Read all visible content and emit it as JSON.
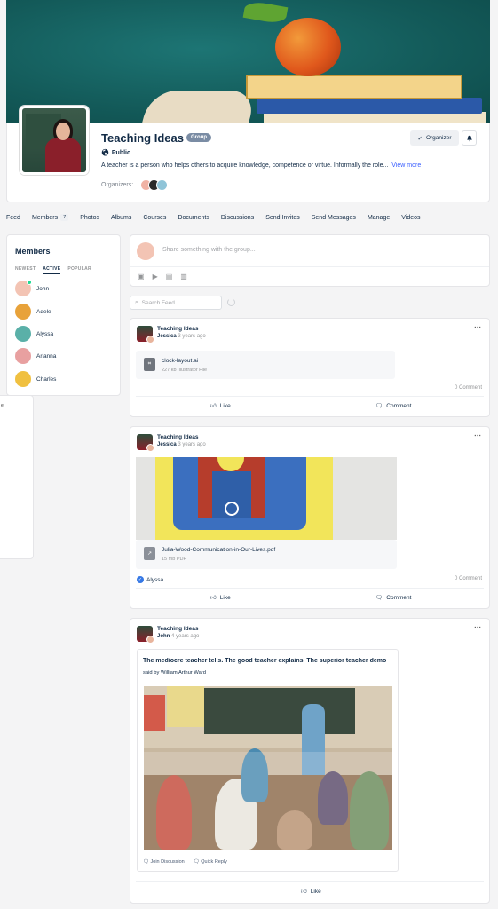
{
  "group": {
    "title": "Teaching Ideas",
    "badge": "Group",
    "privacy": "Public",
    "description": "A teacher is a person who helps others to acquire knowledge, competence or virtue. Informally the role...",
    "view_more": "View more",
    "organizers_label": "Organizers:",
    "organizer_button": "Organizer"
  },
  "nav": {
    "items": [
      "Feed",
      "Members",
      "Photos",
      "Albums",
      "Courses",
      "Documents",
      "Discussions",
      "Send Invites",
      "Send Messages",
      "Manage",
      "Videos"
    ],
    "members_count": "7"
  },
  "members": {
    "title": "Members",
    "tabs": [
      "NEWEST",
      "ACTIVE",
      "POPULAR"
    ],
    "list": [
      "John",
      "Adele",
      "Alyssa",
      "Arianna",
      "Charles"
    ],
    "colors": [
      "#f3c4b4",
      "#e8a23a",
      "#5ab0a8",
      "#e8a0a0",
      "#f0c040"
    ]
  },
  "composer": {
    "placeholder": "Share something with the group..."
  },
  "search": {
    "placeholder": "Search Feed..."
  },
  "posts": [
    {
      "group": "Teaching Ideas",
      "author": "Jessica",
      "time": "3 years ago",
      "file_name": "clock-layout.ai",
      "file_meta": "227 kb  Illustrator File",
      "comments": "0 Comment",
      "like": "Like",
      "comment": "Comment"
    },
    {
      "group": "Teaching Ideas",
      "author": "Jessica",
      "time": "3 years ago",
      "file_name": "Julia-Wood-Communication-in-Our-Lives.pdf",
      "file_meta": "15 mb  PDF",
      "reactor": "Alyssa",
      "comments": "0 Comment",
      "like": "Like",
      "comment": "Comment"
    },
    {
      "group": "Teaching Ideas",
      "author": "John",
      "time": "4 years ago",
      "quote": "The mediocre teacher tells. The good teacher explains. The superior teacher demo",
      "quote_author": "said by William Arthur Ward",
      "join_discussion": "Join Discussion",
      "quick_reply": "Quick Reply",
      "like": "Like"
    }
  ],
  "ghost_panel": {
    "text": "e"
  }
}
